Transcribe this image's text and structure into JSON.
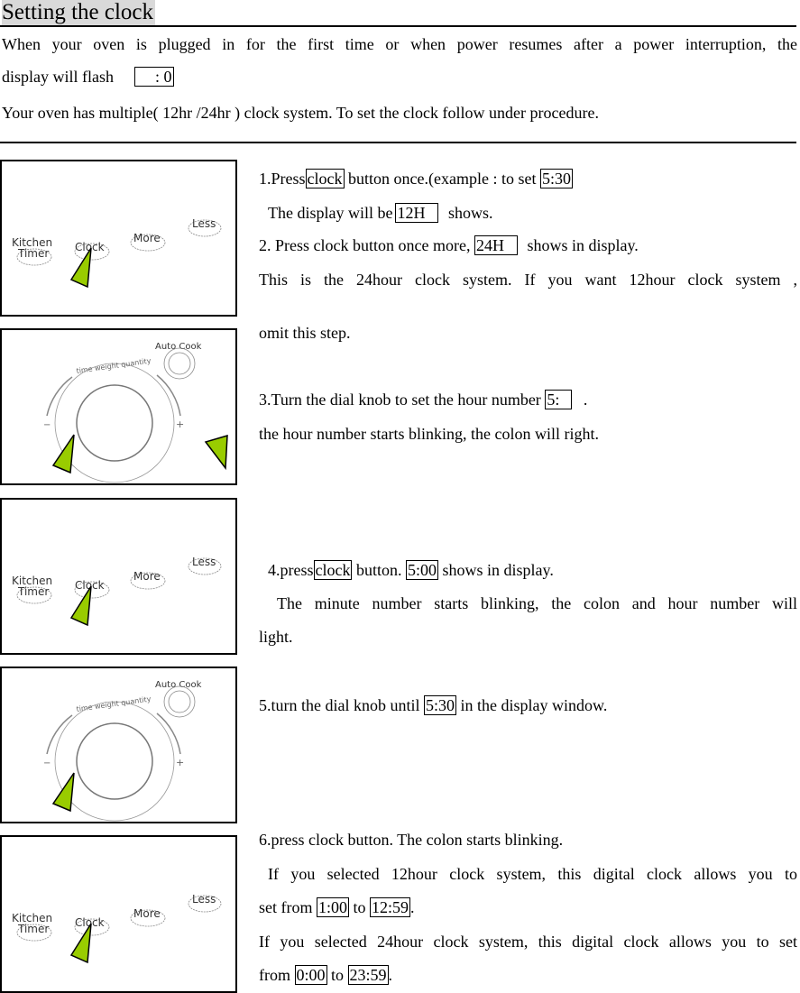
{
  "header": {
    "title": "Setting the clock"
  },
  "intro": {
    "line1": "When your oven is plugged in for the first time or when power resumes after a power interruption, the",
    "line2_prefix": "display will flash",
    "flash_display": ": 0",
    "line3": "Your oven has multiple( 12hr /24hr ) clock system. To set the clock follow under procedure."
  },
  "panels": {
    "buttons": {
      "kitchen_timer": "Kitchen",
      "kitchen_timer_2": "Timer",
      "clock": "Clock",
      "more": "More",
      "less": "Less"
    },
    "dial": {
      "auto_cook": "Auto Cook",
      "arc_label": "time weight quantity",
      "minus": "−",
      "plus": "+"
    },
    "pointer_color": "#99cc00"
  },
  "steps": {
    "s1": {
      "a": "1.Press",
      "box1": "clock",
      "b": "button once.(example : to set",
      "box2": "5:30"
    },
    "s1_line2": {
      "a": "The display will be",
      "box": "12H  ",
      "b": "shows."
    },
    "s2": {
      "a": "2. Press clock button once more,",
      "box": "24H  ",
      "b": "shows in display."
    },
    "s2_line2": "This is the 24hour clock system. If you want 12hour clock system ,",
    "s2_line3": "omit this step.",
    "s3": {
      "a": "3.Turn the dial knob to set the hour number",
      "box": "5:  ",
      "b": "."
    },
    "s3_line2": "the hour number starts blinking, the colon will right.",
    "s4": {
      "a": "4.press",
      "box1": "clock",
      "b": "button.",
      "box2": "5:00",
      "c": "shows in display."
    },
    "s4_line2": "The minute number starts blinking, the colon and hour number will",
    "s4_line3": "light.",
    "s5": {
      "a": "5.turn the dial knob until",
      "box": "5:30",
      "b": "in the display window."
    },
    "s6": "6.press clock button. The colon starts blinking.",
    "s6_line2": "If you selected 12hour clock system, this digital clock allows you to",
    "s6_line3": {
      "a": "set from",
      "box1": "1:00",
      "b": "to",
      "box2": "12:59",
      "c": "."
    },
    "s6_line4": "If you selected 24hour clock system, this digital clock allows you to set",
    "s6_line5": {
      "a": "from",
      "box1": "0:00",
      "b": "to",
      "box2": "23:59",
      "c": "."
    }
  }
}
